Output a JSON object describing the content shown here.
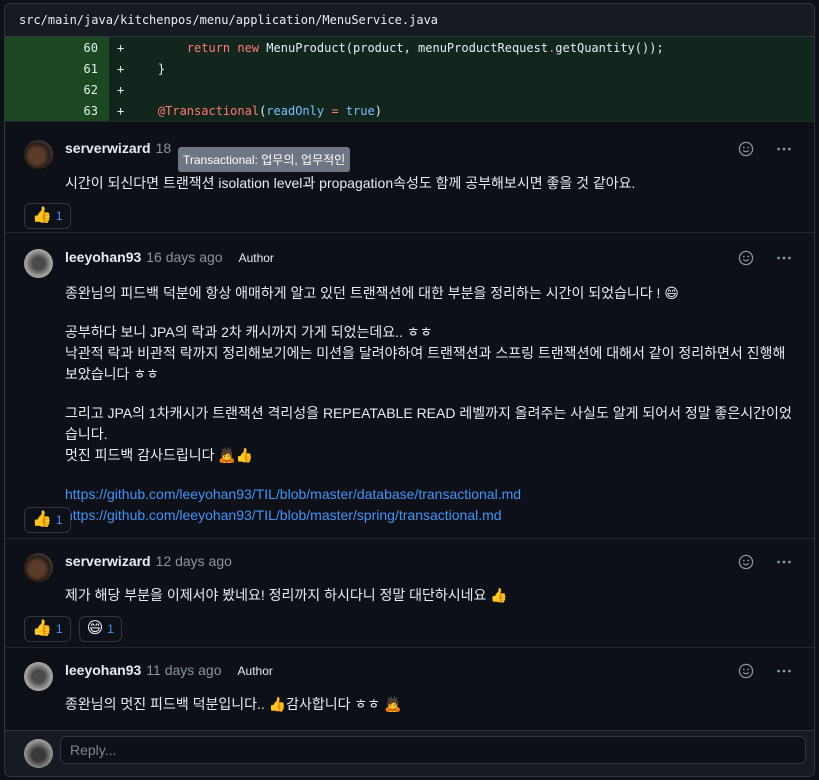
{
  "file": {
    "path": "src/main/java/kitchenpos/menu/application/MenuService.java"
  },
  "diff_lines": [
    {
      "num": "60",
      "sign": "+",
      "code_parts": [
        {
          "t": "        ",
          "c": ""
        },
        {
          "t": "return",
          "c": "kw"
        },
        {
          "t": " ",
          "c": ""
        },
        {
          "t": "new",
          "c": "kw"
        },
        {
          "t": " MenuProduct(product, menuProductRequest",
          "c": ""
        },
        {
          "t": ".",
          "c": "kw"
        },
        {
          "t": "getQuantity());",
          "c": ""
        }
      ]
    },
    {
      "num": "61",
      "sign": "+",
      "code_parts": [
        {
          "t": "    }",
          "c": ""
        }
      ]
    },
    {
      "num": "62",
      "sign": "+",
      "code_parts": [
        {
          "t": "",
          "c": ""
        }
      ]
    },
    {
      "num": "63",
      "sign": "+",
      "code_parts": [
        {
          "t": "    ",
          "c": ""
        },
        {
          "t": "@Transactional",
          "c": "kw"
        },
        {
          "t": "(",
          "c": ""
        },
        {
          "t": "readOnly",
          "c": "cn"
        },
        {
          "t": " ",
          "c": ""
        },
        {
          "t": "=",
          "c": "kw"
        },
        {
          "t": " ",
          "c": ""
        },
        {
          "t": "true",
          "c": "cn"
        },
        {
          "t": ")",
          "c": ""
        }
      ]
    }
  ],
  "tooltip": "Transactional: 업무의, 업무적인",
  "comments": [
    {
      "author": "serverwizard",
      "time": "18",
      "badge": "",
      "paragraphs": [
        "시간이 되신다면 트랜잭션 isolation level과 propagation속성도 함께 공부해보시면 좋을 것 같아요."
      ],
      "reactions": [
        {
          "emoji": "👍",
          "count": "1"
        }
      ]
    },
    {
      "author": "leeyohan93",
      "time": "16 days ago",
      "badge": "Author",
      "paragraphs": [
        "종완님의 피드백 덕분에 항상 애매하게 알고 있던 트랜잭션에 대한 부분을 정리하는 시간이 되었습니다 ! 😄",
        "공부하다 보니 JPA의 락과 2차 캐시까지 가게 되었는데요.. ㅎㅎ\n낙관적 락과 비관적 락까지 정리해보기에는 미션을 달려야하여 트랜잭션과 스프링 트랜잭션에 대해서 같이 정리하면서 진행해보았습니다 ㅎㅎ",
        "그리고 JPA의 1차캐시가 트랜잭션 격리성을 REPEATABLE READ 레벨까지 올려주는 사실도 알게 되어서 정말 좋은시간이었습니다.\n멋진 피드백 감사드립니다 🙇👍"
      ],
      "links": [
        "https://github.com/leeyohan93/TIL/blob/master/database/transactional.md",
        "https://github.com/leeyohan93/TIL/blob/master/spring/transactional.md"
      ],
      "reactions": [
        {
          "emoji": "👍",
          "count": "1"
        }
      ]
    },
    {
      "author": "serverwizard",
      "time": "12 days ago",
      "badge": "",
      "paragraphs": [
        "제가 해당 부분을 이제서야 봤네요! 정리까지 하시다니 정말 대단하시네요 👍"
      ],
      "reactions": [
        {
          "emoji": "👍",
          "count": "1"
        },
        {
          "emoji": "😄",
          "count": "1"
        }
      ]
    },
    {
      "author": "leeyohan93",
      "time": "11 days ago",
      "badge": "Author",
      "paragraphs": [
        "종완님의 멋진 피드백 덕분입니다.. 👍감사합니다 ㅎㅎ 🙇"
      ],
      "reactions": []
    }
  ],
  "reply": {
    "placeholder": "Reply..."
  },
  "icons": {
    "emoji_picker": "smiley-icon",
    "more": "kebab-horizontal-icon"
  },
  "colors": {
    "link": "#4493f8",
    "diff_bg": "#12261e",
    "keyword": "#ff7b72",
    "constant": "#79c0ff"
  }
}
